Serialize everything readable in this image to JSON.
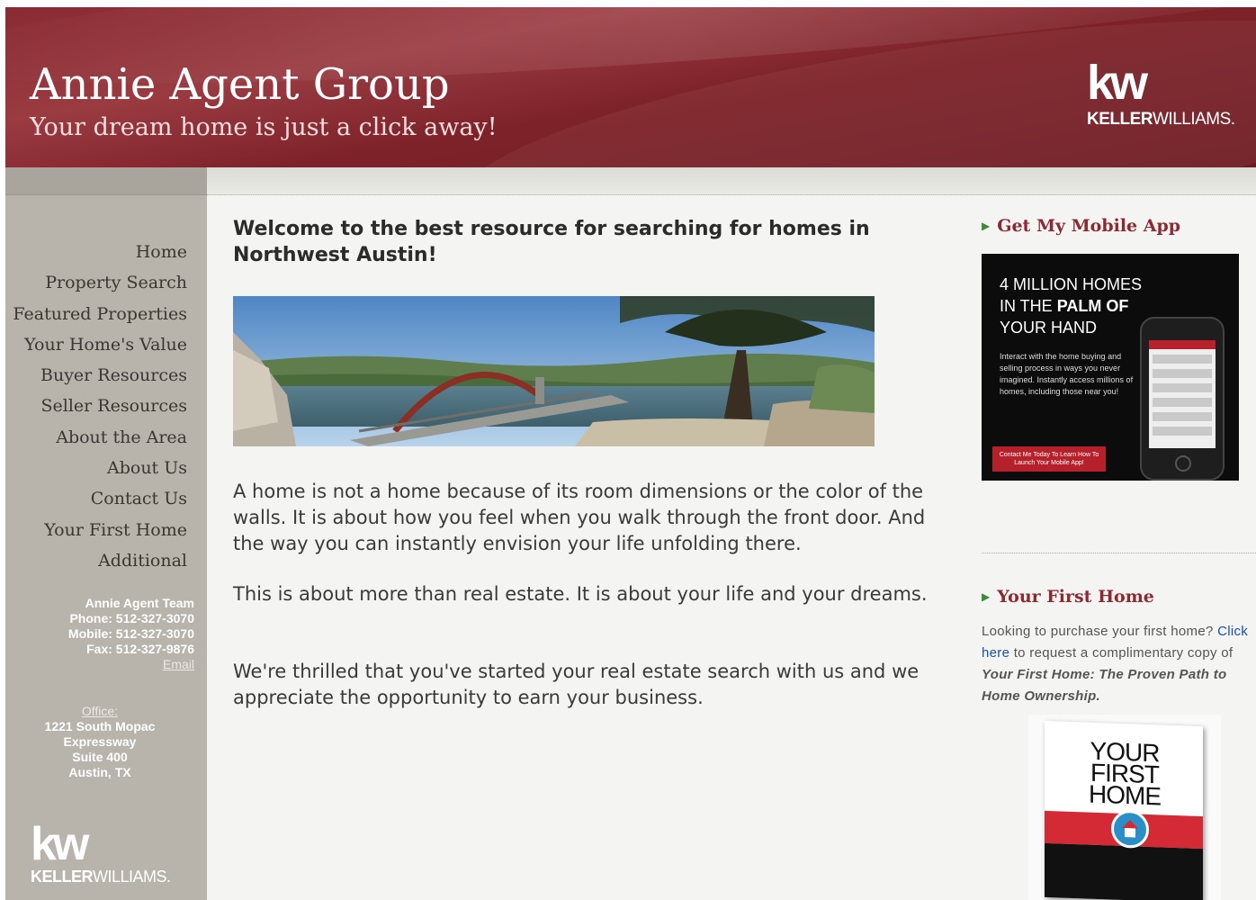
{
  "header": {
    "title": "Annie Agent Group",
    "tagline": "Your dream home is just a click away!",
    "logo_mark": "kw",
    "logo_word_bold": "KELLER",
    "logo_word_light": "WILLIAMS."
  },
  "nav": {
    "items": [
      "Home",
      "Property Search",
      "Featured Properties",
      "Your Home's Value",
      "Buyer Resources",
      "Seller Resources",
      "About the Area",
      "About Us",
      "Contact Us",
      "Your First Home",
      "Additional"
    ]
  },
  "contact": {
    "team": "Annie Agent Team",
    "phone": "Phone: 512-327-3070",
    "mobile": "Mobile: 512-327-3070",
    "fax": "Fax: 512-327-9876",
    "email": "Email"
  },
  "office": {
    "label": "Office:",
    "line1": "1221 South Mopac",
    "line2": "Expressway",
    "line3": "Suite 400",
    "line4": "Austin, TX"
  },
  "main": {
    "welcome": "Welcome to the best resource for searching for homes in Northwest Austin!",
    "para1": "A home is not a home because of its room dimensions or the color of the walls. It is about how you feel when you walk through the front door. And the way you can instantly envision your life unfolding there.",
    "para2": "This is about more than real estate. It is about your life and your dreams.",
    "para3": "We're thrilled that you've started your real estate search with us and we appreciate the opportunity to earn your business."
  },
  "right": {
    "app_title": "Get My Mobile App",
    "app_head_1": "4 MILLION HOMES",
    "app_head_2a": "IN THE ",
    "app_head_2b": "PALM OF",
    "app_head_3": "YOUR HAND",
    "app_body": "Interact with the home buying and selling process in ways you never imagined. Instantly access millions of homes, including those near you!",
    "app_button": "Contact Me Today To Learn How To Launch Your Mobile App!",
    "first_title": "Your First Home",
    "first_text_1": "Looking to purchase your first home? ",
    "first_link_1": "Click here",
    "first_text_2": " to request a complimentary copy of ",
    "first_book_italic": "Your First Home: The Proven Path to Home Ownership.",
    "book_title": "YOUR FIRST HOME"
  },
  "colors": {
    "header_red": "#8a2a32",
    "sidebar_gray": "#b8b3ab",
    "accent_title": "#8b2a32",
    "link_blue": "#1b4fa8"
  }
}
